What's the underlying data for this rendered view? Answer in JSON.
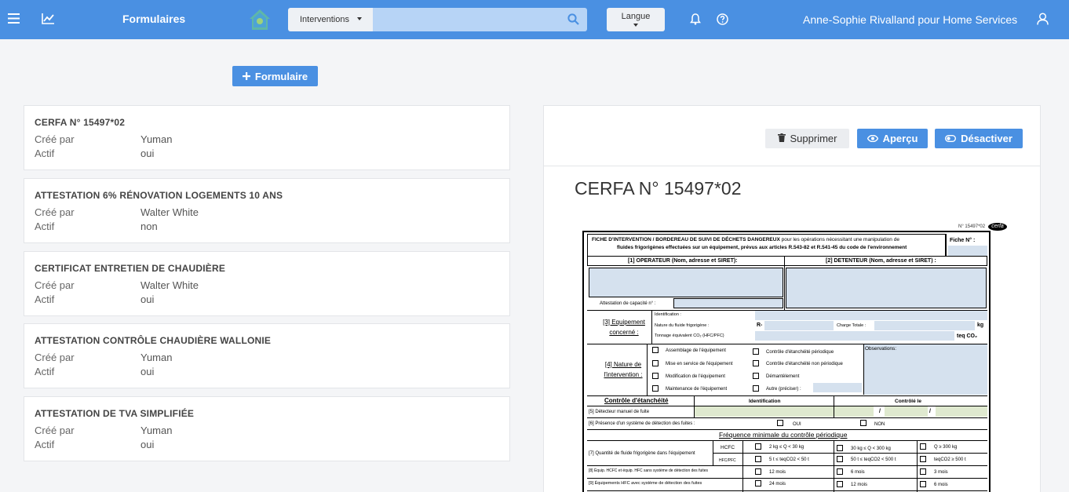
{
  "header": {
    "title": "Formulaires",
    "search": {
      "category": "Interventions",
      "value": "",
      "placeholder": ""
    },
    "language_label": "Langue",
    "user_label": "Anne-Sophie Rivalland pour Home Services"
  },
  "add_button_label": "Formulaire",
  "forms": [
    {
      "title": "CERFA N° 15497*02",
      "created_by_label": "Créé par",
      "created_by": "Yuman",
      "active_label": "Actif",
      "active": "oui"
    },
    {
      "title": "ATTESTATION 6% RÉNOVATION LOGEMENTS 10 ANS",
      "created_by_label": "Créé par",
      "created_by": "Walter White",
      "active_label": "Actif",
      "active": "non"
    },
    {
      "title": "CERTIFICAT ENTRETIEN DE CHAUDIÈRE",
      "created_by_label": "Créé par",
      "created_by": "Walter White",
      "active_label": "Actif",
      "active": "oui"
    },
    {
      "title": "ATTESTATION CONTRÔLE CHAUDIÈRE WALLONIE",
      "created_by_label": "Créé par",
      "created_by": "Yuman",
      "active_label": "Actif",
      "active": "oui"
    },
    {
      "title": "ATTESTATION DE TVA SIMPLIFIÉE",
      "created_by_label": "Créé par",
      "created_by": "Yuman",
      "active_label": "Actif",
      "active": "oui"
    }
  ],
  "detail": {
    "delete_label": "Supprimer",
    "preview_label": "Aperçu",
    "deactivate_label": "Désactiver",
    "title": "CERFA N° 15497*02"
  },
  "document": {
    "ref": "N° 15497*02",
    "cerfa_logo": "cerfa",
    "heading_bold": "FICHE D'INTERVENTION / BORDEREAU DE SUIVI DE DÉCHETS DANGEREUX",
    "heading_rest": "pour les opérations nécessitant une manipulation de",
    "heading_line2": "fluides frigorigènes effectuées sur un équipement, prévus aux articles R.543-82 et R.541-45 du code de l'environnement",
    "fiche_label": "Fiche N° :",
    "operator_label": "[1] OPERATEUR (Nom, adresse et SIRET):",
    "holder_label": "[2] DETENTEUR (Nom, adresse et SIRET) :",
    "capacity_label": "Attestation de capacité n° :",
    "equipment_label": "[3] Equipement concerné :",
    "identification_label": "Identification :",
    "fluid_label": "Nature du fluide frigorigène :",
    "fluid_prefix": "R-",
    "charge_label": "Charge Totale :",
    "charge_unit": "kg",
    "tonnage_label": "Tonnage équivalent CO₂ (HFC/PFC)",
    "tonnage_unit": "teq CO₂",
    "intervention_label": "[4] Nature de l'intervention :",
    "interventions_left": [
      "Assemblage de l'équipement",
      "Mise en service de l'équipement",
      "Modification de l'équipement",
      "Maintenance de l'équipement"
    ],
    "interventions_right": [
      "Contrôle d'étanchéité périodique",
      "Contrôle d'étanchéité non périodique",
      "Démantèlement",
      "Autre (préciser) :"
    ],
    "observations_label": "Observations:",
    "leak_control_label": "Contrôle d'étanchéité",
    "identification_col": "Identification",
    "controlled_col": "Contrôlé le",
    "detector_label": "[5] Détecteur manuel de fuite",
    "slash": "/",
    "detection_label": "[6] Présence d'un système de détection des fuites :",
    "yes_label": "OUI",
    "no_label": "NON",
    "frequency_label": "Fréquence minimale du contrôle périodique",
    "quantity_label": "[7] Quantité de fluide frigorigène dans l'équipement",
    "hcfc_label": "HCFC",
    "hfc_label": "HFC/PFC",
    "thresholds_hcfc": [
      "2 kg ≤ Q < 30 kg",
      "30 kg ≤ Q < 300 kg",
      "Q ≥ 300 kg"
    ],
    "thresholds_hfc": [
      "5 t ≤ teqCO2 < 50 t",
      "50 t ≤ teqCO2 < 500 t",
      "teqCO2 ≥ 500 t"
    ],
    "row8_label": "[8] Équip. HCFC et équip. HFC sans système de détection des fuites",
    "row8_values": [
      "12 mois",
      "6 mois",
      "3 mois"
    ],
    "row9_label": "[9] Équipements HFC avec système de détection des fuites",
    "row9_values": [
      "24 mois",
      "12 mois",
      "6 mois"
    ]
  },
  "colors": {
    "primary": "#4a90e2",
    "form_blue": "#d5e1ee",
    "form_green": "#dfe9cf"
  }
}
